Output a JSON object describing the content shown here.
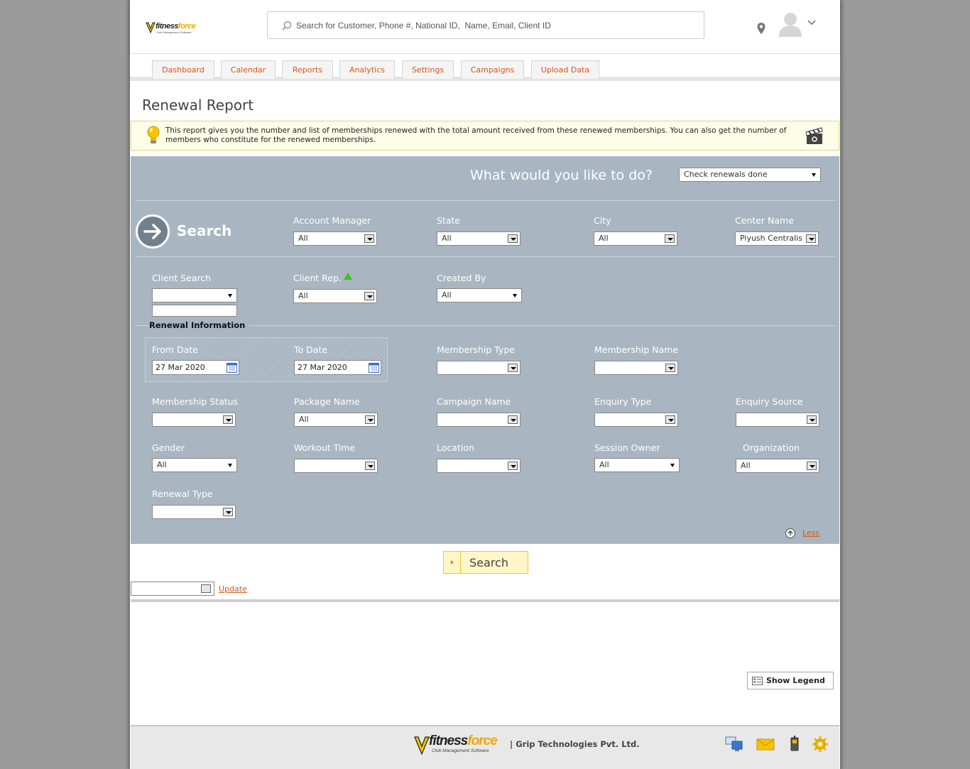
{
  "header": {
    "logo": {
      "brand_a": "fitness",
      "brand_b": "force",
      "tagline": "Club Management Software"
    },
    "search_placeholder": "Search for Customer, Phone #, National ID,  Name, Email, Client ID"
  },
  "nav": {
    "tabs": [
      {
        "label": "Dashboard"
      },
      {
        "label": "Calendar"
      },
      {
        "label": "Reports"
      },
      {
        "label": "Analytics"
      },
      {
        "label": "Settings"
      },
      {
        "label": "Campaigns"
      },
      {
        "label": "Upload Data"
      }
    ]
  },
  "page": {
    "title": "Renewal Report",
    "info_text": "This report gives you the number and list of memberships renewed with the total amount received from these renewed memberships. You can also get the number of members who constitute for the renewed memberships."
  },
  "filters": {
    "question": "What would you like to do?",
    "action_value": "Check renewals done",
    "search_label": "Search",
    "account_manager": {
      "label": "Account Manager",
      "value": "All"
    },
    "state": {
      "label": "State",
      "value": "All"
    },
    "city": {
      "label": "City",
      "value": "All"
    },
    "center_name": {
      "label": "Center Name",
      "value": "Piyush Centralis"
    },
    "client_search": {
      "label": "Client Search",
      "value": ""
    },
    "client_rep": {
      "label": "Client Rep.",
      "value": "All"
    },
    "created_by": {
      "label": "Created By",
      "value": "All"
    },
    "renewal_info_label": "Renewal Information",
    "from_date": {
      "label": "From Date",
      "value": "27 Mar 2020"
    },
    "to_date": {
      "label": "To Date",
      "value": "27 Mar 2020"
    },
    "membership_type": {
      "label": "Membership Type",
      "value": ""
    },
    "membership_name": {
      "label": "Membership Name",
      "value": ""
    },
    "membership_status": {
      "label": "Membership Status",
      "value": ""
    },
    "package_name": {
      "label": "Package Name",
      "value": "All"
    },
    "campaign_name": {
      "label": "Campaign Name",
      "value": ""
    },
    "enquiry_type": {
      "label": "Enquiry Type",
      "value": ""
    },
    "enquiry_source": {
      "label": "Enquiry Source",
      "value": ""
    },
    "gender": {
      "label": "Gender",
      "value": "All"
    },
    "workout_time": {
      "label": "Workout Time",
      "value": ""
    },
    "location": {
      "label": "Location",
      "value": ""
    },
    "session_owner": {
      "label": "Session Owner",
      "value": "All"
    },
    "organization": {
      "label": "Organization",
      "value": "All"
    },
    "renewal_type": {
      "label": "Renewal Type",
      "value": ""
    },
    "less_label": "Less"
  },
  "actions": {
    "search_button": "Search",
    "update_link": "Update",
    "show_legend": "Show Legend"
  },
  "footer": {
    "logo": {
      "brand_a": "fitness",
      "brand_b": "force",
      "tagline": "Club Management Software"
    },
    "company": "| Grip Technologies Pvt. Ltd.",
    "icons": [
      "computer-icon",
      "mail-icon",
      "phone-icon",
      "settings-icon"
    ]
  },
  "colors": {
    "accent": "#d2581c",
    "brand_yellow": "#f0a800",
    "panel": "#a9b6c1"
  }
}
